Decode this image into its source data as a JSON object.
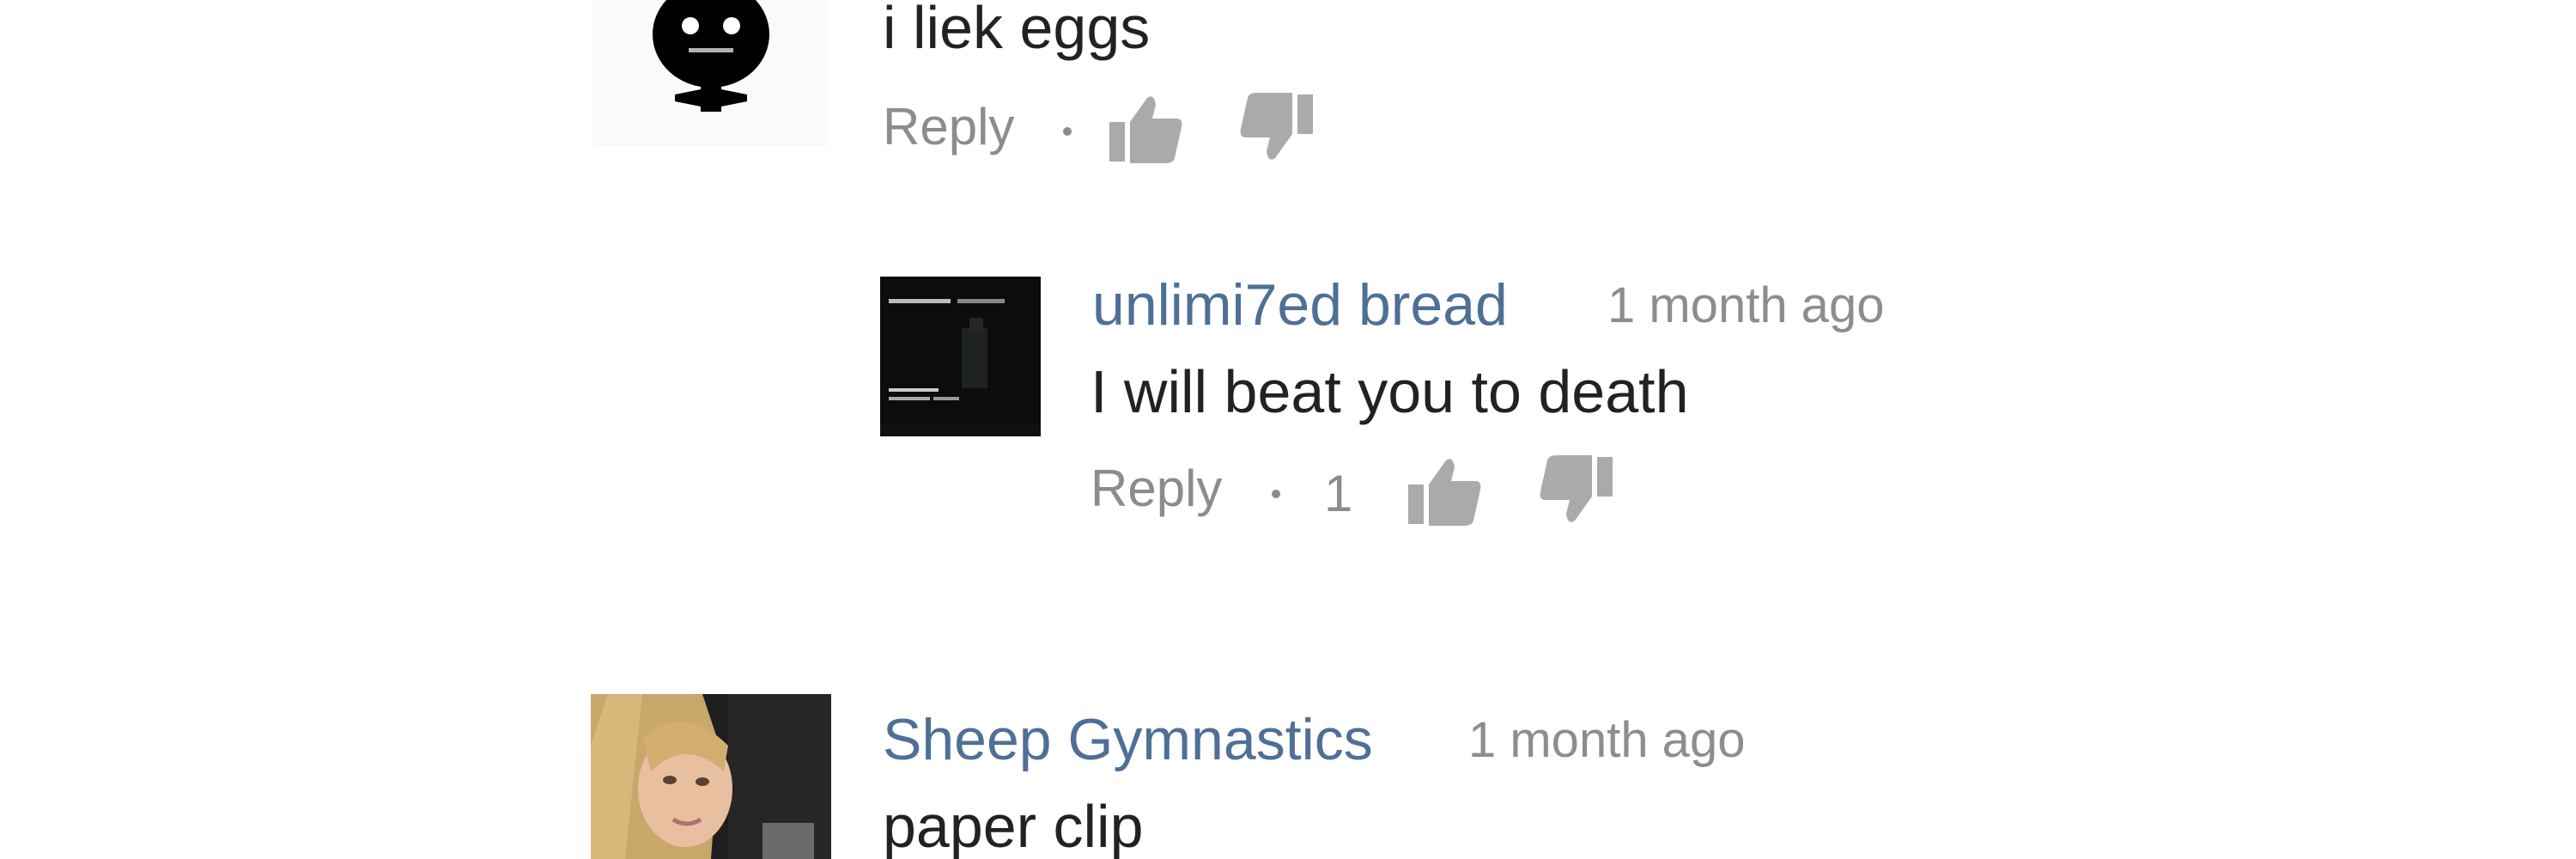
{
  "comments": [
    {
      "author": "",
      "time": "",
      "text": "i liek eggs",
      "reply_label": "Reply",
      "like_count": "",
      "avatar_icon": "robot-icon"
    },
    {
      "author": "unlimi7ed bread",
      "time": "1 month ago",
      "text": "I will beat you to death",
      "reply_label": "Reply",
      "like_count": "1",
      "avatar_icon": "dark-image-avatar"
    },
    {
      "author": "Sheep Gymnastics",
      "time": "1 month ago",
      "text": "paper clip",
      "reply_label": "",
      "like_count": "",
      "avatar_icon": "photo-avatar"
    }
  ],
  "colors": {
    "author": "#4f6f97",
    "meta": "#8d8d8d",
    "text": "#222222",
    "icon": "#aaaaaa"
  }
}
